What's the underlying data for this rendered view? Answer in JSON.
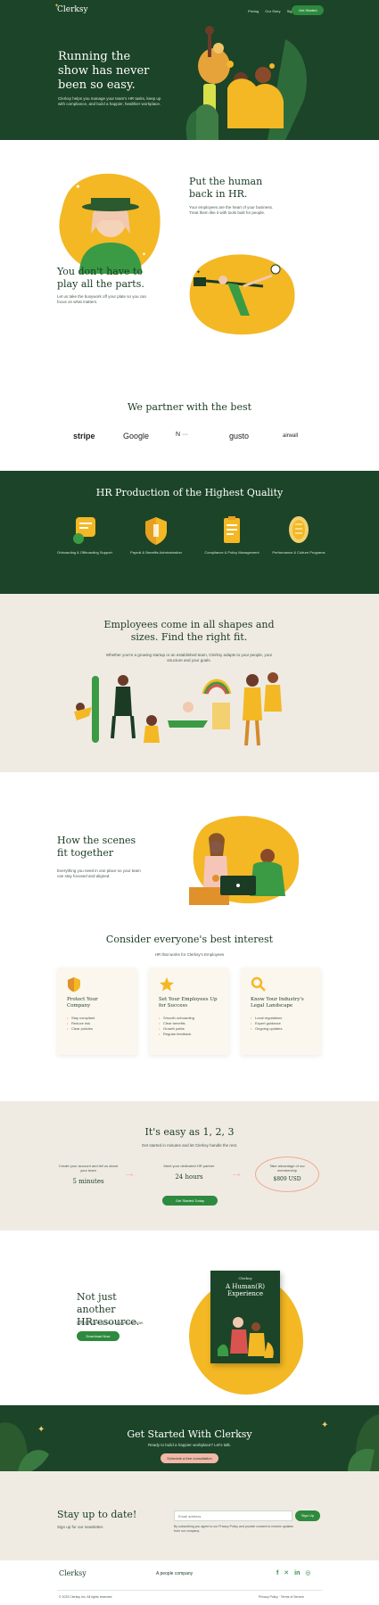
{
  "nav": {
    "brand": "Clerksy",
    "links": [
      "Pricing",
      "Our Story",
      "Sign in"
    ],
    "cta": "Get Started"
  },
  "hero": {
    "title": "Running the show has never been so easy.",
    "body": "Clerksy helps you manage your team's HR tasks, keep up with compliance, and build a happier, healthier workplace."
  },
  "section_human": {
    "title": "Put the human back in HR.",
    "body": "Your employees are the heart of your business. Treat them like it with tools built for people."
  },
  "section_parts": {
    "title": "You don't have to play all the parts.",
    "body": "Let us take the busywork off your plate so you can focus on what matters."
  },
  "partners": {
    "title": "We partner with the best",
    "logos": [
      "stripe",
      "Google",
      "N ···",
      "gusto",
      "airwall"
    ]
  },
  "quality": {
    "title": "HR Production of the Highest Quality",
    "items": [
      {
        "icon": "chat-icon",
        "label": "Onboarding & Offboarding Support"
      },
      {
        "icon": "shield-icon",
        "label": "Payroll & Benefits Administration"
      },
      {
        "icon": "clipboard-icon",
        "label": "Compliance & Policy Management"
      },
      {
        "icon": "badge-icon",
        "label": "Performance & Culture Programs"
      }
    ]
  },
  "shapes": {
    "title": "Employees come in all shapes and sizes. Find the right fit.",
    "body": "Whether you're a growing startup or an established team, Clerksy adapts to your people, your structure and your goals."
  },
  "scenes": {
    "title": "How the scenes fit together",
    "body": "Everything you need in one place so your team can stay focused and aligned."
  },
  "interest": {
    "title": "Consider everyone's best interest",
    "subtitle": "HR that works for Clerksy's Employees",
    "cards": [
      {
        "icon": "shield-icon",
        "title": "Protect Your Company",
        "bullets": [
          "Stay compliant",
          "Reduce risk",
          "Clear policies"
        ]
      },
      {
        "icon": "star-icon",
        "title": "Set Your Employees Up for Success",
        "bullets": [
          "Smooth onboarding",
          "Clear benefits",
          "Growth paths",
          "Regular feedback"
        ]
      },
      {
        "icon": "search-icon",
        "title": "Know Your Industry's Legal Landscape",
        "bullets": [
          "Local regulations",
          "Expert guidance",
          "Ongoing updates"
        ]
      }
    ]
  },
  "steps": {
    "title": "It's easy as 1, 2, 3",
    "subtitle": "Get started in minutes and let Clerksy handle the rest.",
    "items": [
      {
        "label": "Create your account and tell us about your team",
        "value": "5 minutes"
      },
      {
        "label": "Meet your dedicated HR partner",
        "value": "24 hours"
      },
      {
        "label": "Take advantage of our membership",
        "value": "$809 USD"
      }
    ],
    "cta": "Get Started Today"
  },
  "resource": {
    "title": "Not just another HRresource.",
    "body": "Get the Clerksy book. Download now.",
    "cta": "Download Now",
    "book_brand": "Clerksy",
    "book_title": "A Human(R) Experience"
  },
  "getstarted": {
    "title": "Get Started With Clerksy",
    "body": "Ready to build a happier workplace? Let's talk.",
    "cta": "Schedule a free consultation"
  },
  "newsletter": {
    "title": "Stay up to date!",
    "body": "Sign up for our newsletter.",
    "placeholder": "Email address",
    "cta": "Sign Up",
    "fine_print": "By subscribing you agree to our Privacy Policy and provide consent to receive updates from our company."
  },
  "footer": {
    "brand": "Clerksy",
    "tagline": "A people company",
    "copyright": "© 2023 Clerksy Inc. All rights reserved.",
    "legal": "Privacy Policy · Terms of Service"
  },
  "colors": {
    "primary_green": "#1c4428",
    "accent_yellow": "#f3b824",
    "button_green": "#2d8a3e",
    "cream": "#efebe3"
  }
}
